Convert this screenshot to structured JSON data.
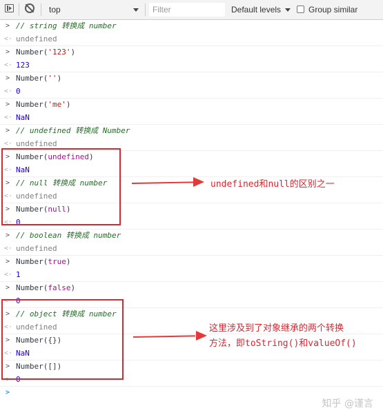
{
  "toolbar": {
    "context": "top",
    "filter_placeholder": "Filter",
    "levels": "Default levels",
    "group_similar": "Group similar"
  },
  "console": {
    "l1": "// string 转换成 number",
    "l2": "undefined",
    "l3a": "Number(",
    "l3b": "'123'",
    "l3c": ")",
    "l4": "123",
    "l5a": "Number(",
    "l5b": "''",
    "l5c": ")",
    "l6": "0",
    "l7a": "Number(",
    "l7b": "'me'",
    "l7c": ")",
    "l8": "NaN",
    "l9": "// undefined 转换成 Number",
    "l10": "undefined",
    "l11a": "Number(",
    "l11b": "undefined",
    "l11c": ")",
    "l12": "NaN",
    "l13": "// null 转换成 number",
    "l14": "undefined",
    "l15a": "Number(",
    "l15b": "null",
    "l15c": ")",
    "l16": "0",
    "l17": "// boolean 转换成 number",
    "l18": "undefined",
    "l19a": "Number(",
    "l19b": "true",
    "l19c": ")",
    "l20": "1",
    "l21a": "Number(",
    "l21b": "false",
    "l21c": ")",
    "l22": "0",
    "l23": "// object 转换成 number",
    "l24": "undefined",
    "l25": "Number({})",
    "l26": "NaN",
    "l27": "Number([])",
    "l28": "0"
  },
  "annotations": {
    "first": "undefined和null的区别之一",
    "second_line1": "这里涉及到了对象继承的两个转换",
    "second_line2": "方法，即toString()和valueOf()"
  },
  "watermark": "知乎 @谨言",
  "colors": {
    "annotation_red": "#d9262f",
    "comment_green": "#236e25",
    "string_red": "#c41a16",
    "keyword_purple": "#aa0d91",
    "number_blue": "#1c00cf"
  },
  "icons": [
    "panel-toggle-icon",
    "clear-console-icon",
    "chevron-down-icon",
    "checkbox-icon",
    "input-prompt-icon",
    "output-arrow-icon"
  ]
}
